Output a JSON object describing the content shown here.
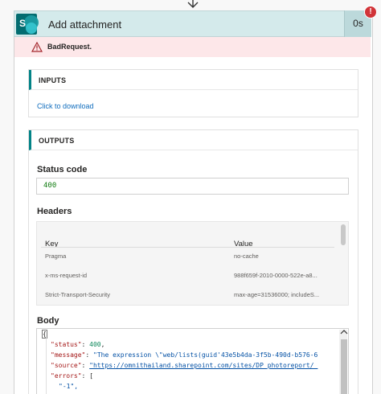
{
  "action": {
    "title": "Add attachment",
    "duration": "0s",
    "error_badge": "!",
    "error_message": "BadRequest."
  },
  "inputs": {
    "heading": "INPUTS",
    "download_link": "Click to download"
  },
  "outputs": {
    "heading": "OUTPUTS",
    "status_code_label": "Status code",
    "status_code": "400",
    "headers_label": "Headers",
    "headers_columns": [
      "Key",
      "Value"
    ],
    "headers_rows": [
      {
        "key": "Pragma",
        "value": "no-cache"
      },
      {
        "key": "x-ms-request-id",
        "value": "988f659f-2010-0000-522e-a8..."
      },
      {
        "key": "Strict-Transport-Security",
        "value": "max-age=31536000; includeS..."
      }
    ],
    "body_label": "Body",
    "body_lines": {
      "l1": "{",
      "status_key": "\"status\"",
      "status_val": "400",
      "message_key": "\"message\"",
      "message_val": "\"The expression \\\"web/lists(guid'43e5b4da-3f5b-490d-b576-6",
      "source_key": "\"source\"",
      "source_val": "\"https://omnithailand.sharepoint.com/sites/DP_photoreport/_",
      "errors_key": "\"errors\"",
      "errors_open": "[",
      "errors_item": "\"-1\","
    }
  },
  "colors": {
    "header_bg": "#d4eaeb",
    "error_bg": "#fde7e9",
    "accent": "#038387",
    "error_red": "#d13438"
  },
  "icons": [
    "arrow-down-icon",
    "sharepoint-icon",
    "warning-icon",
    "chevron-up-icon"
  ]
}
